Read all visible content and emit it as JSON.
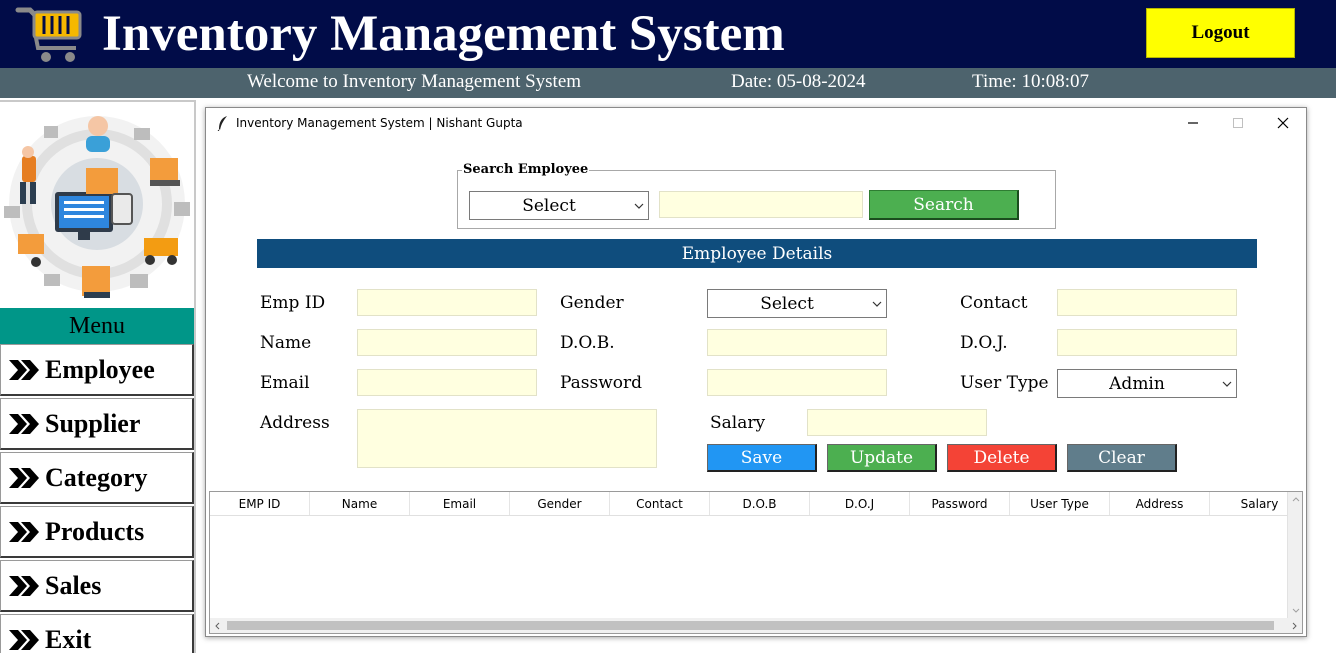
{
  "header": {
    "title": "Inventory Management System",
    "logout_label": "Logout"
  },
  "status": {
    "welcome": "Welcome to Inventory Management System",
    "date": "Date: 05-08-2024",
    "time": "Time: 10:08:07"
  },
  "sidebar": {
    "menu_title": "Menu",
    "items": [
      {
        "label": "Employee"
      },
      {
        "label": "Supplier"
      },
      {
        "label": "Category"
      },
      {
        "label": "Products"
      },
      {
        "label": "Sales"
      },
      {
        "label": "Exit"
      }
    ]
  },
  "dialog": {
    "title": "Inventory Management System | Nishant Gupta"
  },
  "search": {
    "legend": "Search Employee",
    "select_value": "Select",
    "input_value": "",
    "button_label": "Search"
  },
  "details": {
    "banner": "Employee Details",
    "labels": {
      "emp_id": "Emp ID",
      "gender": "Gender",
      "contact": "Contact",
      "name": "Name",
      "dob": "D.O.B.",
      "doj": "D.O.J.",
      "email": "Email",
      "password": "Password",
      "user_type": "User Type",
      "address": "Address",
      "salary": "Salary"
    },
    "gender_value": "Select",
    "user_type_value": "Admin",
    "buttons": {
      "save": "Save",
      "update": "Update",
      "delete": "Delete",
      "clear": "Clear"
    }
  },
  "table": {
    "columns": [
      "EMP ID",
      "Name",
      "Email",
      "Gender",
      "Contact",
      "D.O.B",
      "D.O.J",
      "Password",
      "User Type",
      "Address",
      "Salary"
    ],
    "rows": []
  },
  "colors": {
    "header_bg": "#010c48",
    "status_bg": "#4d636d",
    "menu_header_bg": "#009688",
    "banner_bg": "#0f4d7d",
    "logout_bg": "#ffff00",
    "entry_bg": "#ffffe0",
    "search_btn": "#4caf50",
    "save_btn": "#2196f3",
    "update_btn": "#4caf50",
    "delete_btn": "#f44336",
    "clear_btn": "#607d8b"
  }
}
